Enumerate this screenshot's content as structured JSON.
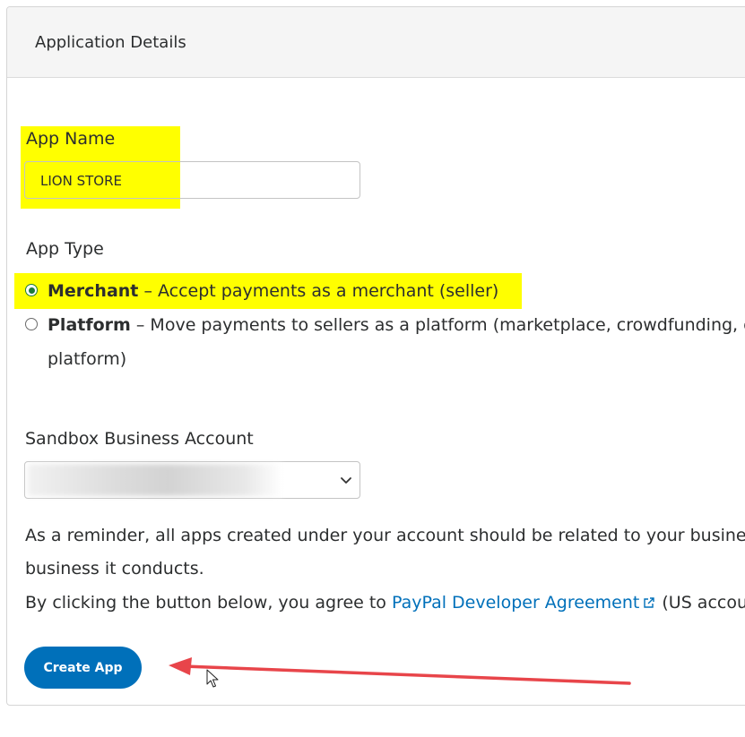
{
  "card": {
    "title": "Application Details"
  },
  "app_name": {
    "label": "App Name",
    "value": "LION STORE"
  },
  "app_type": {
    "label": "App Type",
    "options": [
      {
        "name": "Merchant",
        "description": "– Accept payments as a merchant (seller)",
        "selected": true
      },
      {
        "name": "Platform",
        "description": "– Move payments to sellers as a platform (marketplace, crowdfunding, or",
        "continuation": "platform)",
        "selected": false
      }
    ]
  },
  "sandbox": {
    "label": "Sandbox Business Account",
    "value_obscured": true
  },
  "reminder": {
    "line1": "As a reminder, all apps created under your account should be related to your busines",
    "line2": "business it conducts.",
    "agreement_prefix": "By clicking the button below, you agree to",
    "agreement_link": "PayPal Developer Agreement",
    "agreement_suffix": "(US accou"
  },
  "actions": {
    "create_label": "Create App"
  },
  "annotations": {
    "highlight_color": "#ffff00",
    "arrow_color": "#e8454a",
    "primary_color": "#0070ba",
    "radio_color": "#1e7a3a"
  }
}
